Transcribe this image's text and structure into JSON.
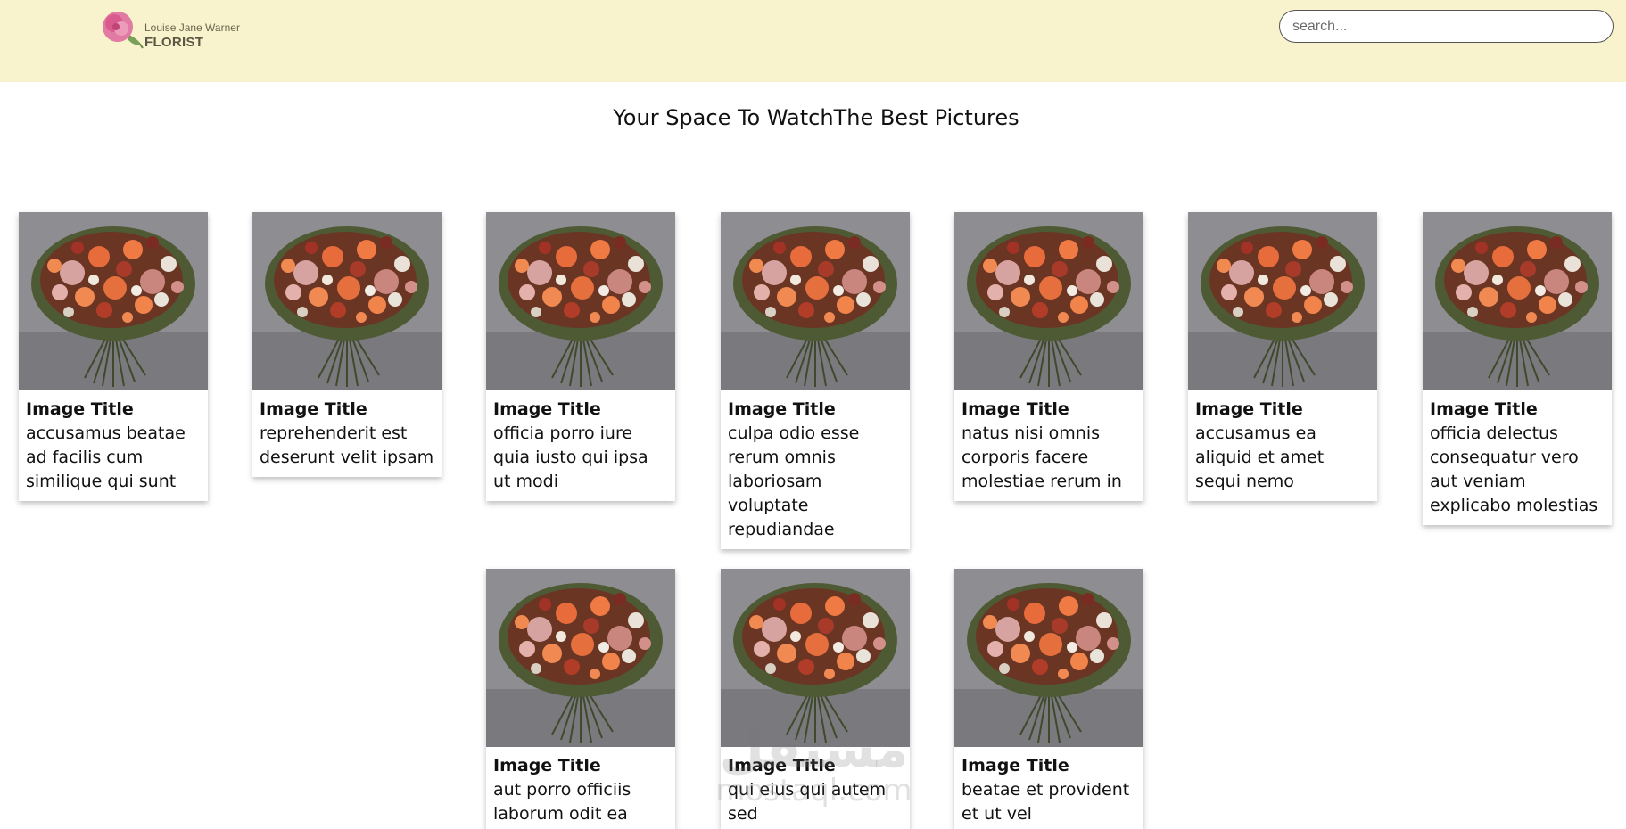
{
  "header": {
    "logo": {
      "line1": "Louise Jane Warner",
      "line2": "FLORIST"
    },
    "search": {
      "placeholder": "search...",
      "value": ""
    }
  },
  "page_title": "Your Space To WatchThe Best Pictures",
  "cards": [
    {
      "title": "Image Title",
      "description": "accusamus beatae ad facilis cum similique qui sunt"
    },
    {
      "title": "Image Title",
      "description": "reprehenderit est deserunt velit ipsam"
    },
    {
      "title": "Image Title",
      "description": "officia porro iure quia iusto qui ipsa ut modi"
    },
    {
      "title": "Image Title",
      "description": "culpa odio esse rerum omnis laboriosam voluptate repudiandae"
    },
    {
      "title": "Image Title",
      "description": "natus nisi omnis corporis facere molestiae rerum in"
    },
    {
      "title": "Image Title",
      "description": "accusamus ea aliquid et amet sequi nemo"
    },
    {
      "title": "Image Title",
      "description": "officia delectus consequatur vero aut veniam explicabo molestias"
    },
    {
      "title": "Image Title",
      "description": "aut porro officiis laborum odit ea"
    },
    {
      "title": "Image Title",
      "description": "qui eius qui autem sed"
    },
    {
      "title": "Image Title",
      "description": "beatae et provident et ut vel"
    }
  ],
  "watermark": {
    "line1": "مستقل",
    "line2": "mostaql.com"
  },
  "colors": {
    "header_bg": "#f8f3cd",
    "photo_bg": "#8c8b90"
  }
}
